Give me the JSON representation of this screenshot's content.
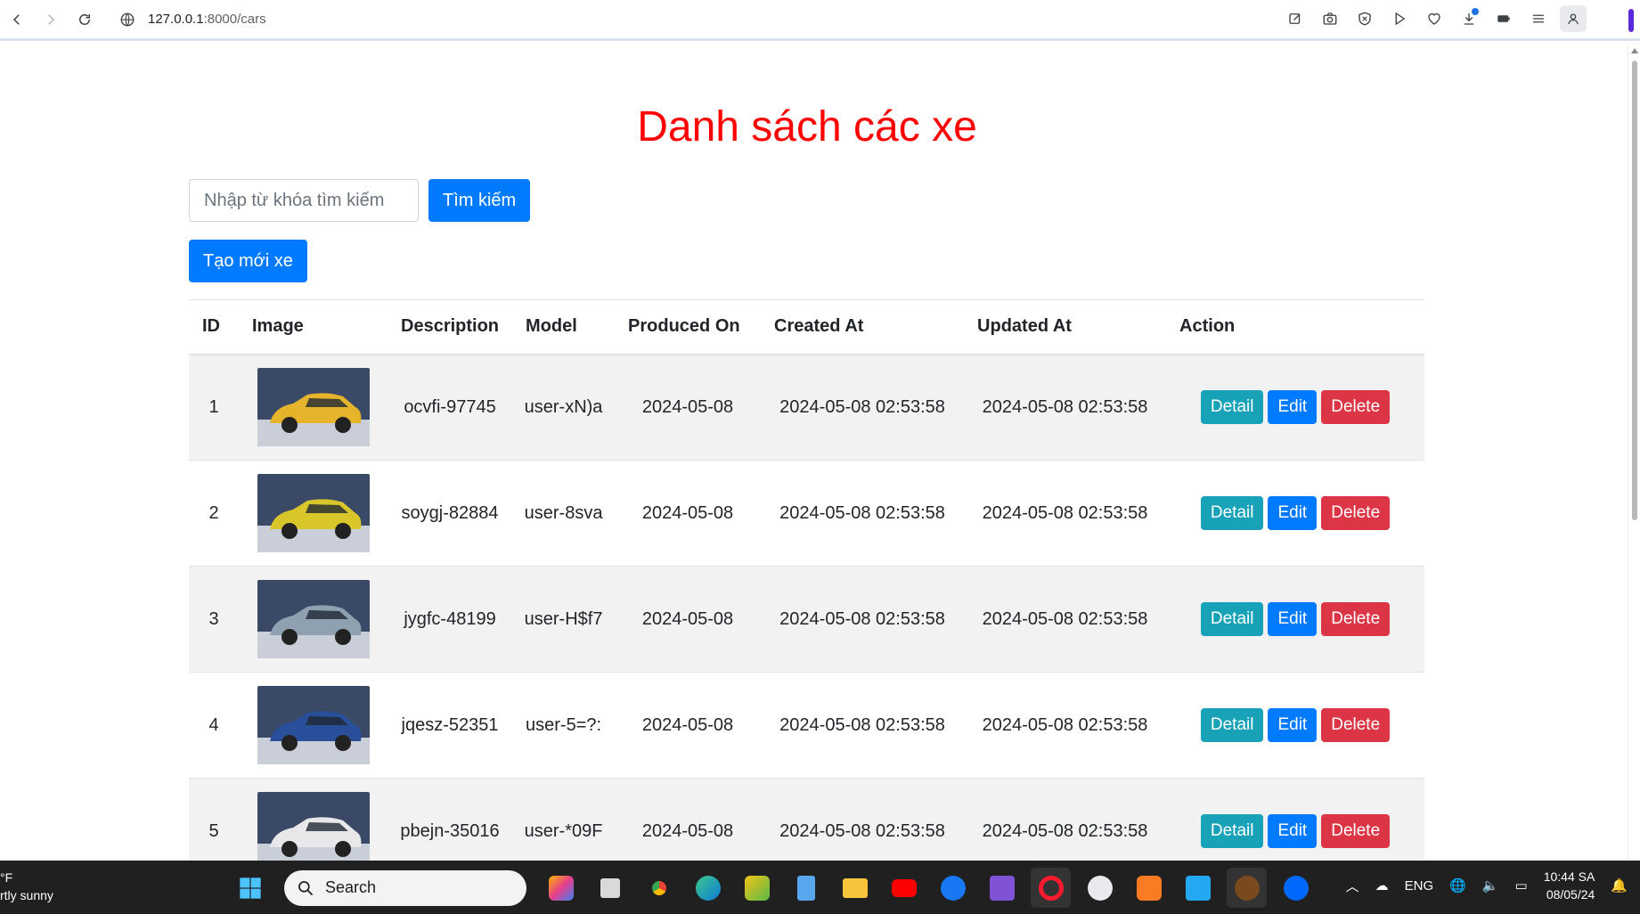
{
  "browser": {
    "url_host": "127.0.0.1",
    "url_rest": ":8000/cars"
  },
  "page": {
    "title": "Danh sách các xe",
    "search": {
      "placeholder": "Nhập từ khóa tìm kiếm",
      "button_label": "Tìm kiếm"
    },
    "create_button_label": "Tạo mới xe",
    "table": {
      "headers": [
        "ID",
        "Image",
        "Description",
        "Model",
        "Produced On",
        "Created At",
        "Updated At",
        "Action"
      ],
      "rows": [
        {
          "id": "1",
          "image_color": "#e5b42a",
          "description": "ocvfi-97745",
          "model": "user-xN)a",
          "produced_on": "2024-05-08",
          "created_at": "2024-05-08 02:53:58",
          "updated_at": "2024-05-08 02:53:58"
        },
        {
          "id": "2",
          "image_color": "#d9c62b",
          "description": "soygj-82884",
          "model": "user-8sva",
          "produced_on": "2024-05-08",
          "created_at": "2024-05-08 02:53:58",
          "updated_at": "2024-05-08 02:53:58"
        },
        {
          "id": "3",
          "image_color": "#8fa0b0",
          "description": "jygfc-48199",
          "model": "user-H$f7",
          "produced_on": "2024-05-08",
          "created_at": "2024-05-08 02:53:58",
          "updated_at": "2024-05-08 02:53:58"
        },
        {
          "id": "4",
          "image_color": "#2a4f9a",
          "description": "jqesz-52351",
          "model": "user-5=?:",
          "produced_on": "2024-05-08",
          "created_at": "2024-05-08 02:53:58",
          "updated_at": "2024-05-08 02:53:58"
        },
        {
          "id": "5",
          "image_color": "#e8e8ea",
          "description": "pbejn-35016",
          "model": "user-*09F",
          "produced_on": "2024-05-08",
          "created_at": "2024-05-08 02:53:58",
          "updated_at": "2024-05-08 02:53:58"
        }
      ],
      "action_labels": {
        "detail": "Detail",
        "edit": "Edit",
        "delete": "Delete"
      }
    }
  },
  "taskbar": {
    "weather_temp": "°F",
    "weather_desc": "rtly sunny",
    "search_label": "Search",
    "language": "ENG",
    "time": "10:44 SA",
    "date": "08/05/24"
  }
}
